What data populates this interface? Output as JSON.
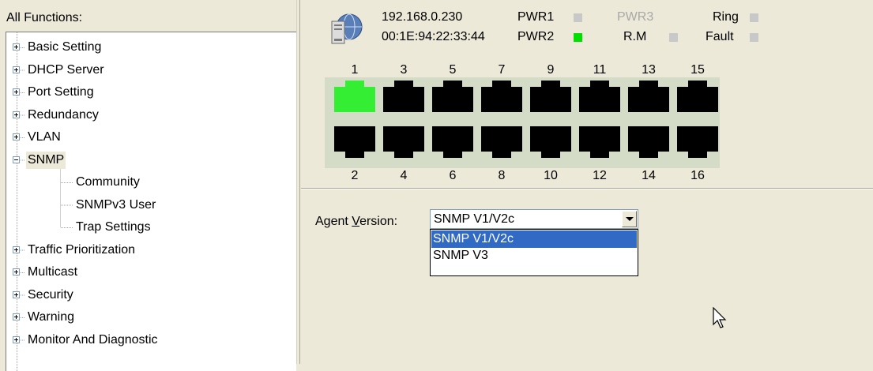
{
  "left": {
    "title": "All Functions:",
    "tree": [
      {
        "label": "Basic Setting",
        "expander": "plus"
      },
      {
        "label": "DHCP Server",
        "expander": "plus"
      },
      {
        "label": "Port Setting",
        "expander": "plus"
      },
      {
        "label": "Redundancy",
        "expander": "plus"
      },
      {
        "label": "VLAN",
        "expander": "plus"
      },
      {
        "label": "SNMP",
        "expander": "minus",
        "selected": true
      },
      {
        "label": "Community",
        "child": true
      },
      {
        "label": "SNMPv3 User",
        "child": true
      },
      {
        "label": "Trap Settings",
        "child": true
      },
      {
        "label": "Traffic Prioritization",
        "expander": "plus"
      },
      {
        "label": "Multicast",
        "expander": "plus"
      },
      {
        "label": "Security",
        "expander": "plus"
      },
      {
        "label": "Warning",
        "expander": "plus"
      },
      {
        "label": "Monitor And Diagnostic",
        "expander": "plus"
      }
    ]
  },
  "status": {
    "ip": "192.168.0.230",
    "mac": "00:1E:94:22:33:44",
    "pwr1": "PWR1",
    "pwr2": "PWR2",
    "pwr3": "PWR3",
    "rm": "R.M",
    "ring": "Ring",
    "fault": "Fault",
    "leds": {
      "pwr1": "off",
      "pwr2": "on",
      "rm": "off",
      "ring": "off",
      "fault": "off"
    },
    "led_colors": {
      "on": "#00e000",
      "off": "#c8c8c8"
    }
  },
  "ports": {
    "top": [
      "1",
      "3",
      "5",
      "7",
      "9",
      "11",
      "13",
      "15"
    ],
    "bottom": [
      "2",
      "4",
      "6",
      "8",
      "10",
      "12",
      "14",
      "16"
    ],
    "active": [
      "1"
    ],
    "colors": {
      "active": "#33ee33",
      "inactive": "#000000",
      "panel": "#d4dbc7"
    }
  },
  "config": {
    "agent_label_pre": "Agent ",
    "agent_label_key": "V",
    "agent_label_post": "ersion:",
    "agent_value": "SNMP V1/V2c",
    "options": [
      "SNMP V1/V2c",
      "SNMP V3"
    ],
    "selected_option": "SNMP V1/V2c"
  },
  "icons": {
    "device": "server-globe-icon",
    "cursor": "mouse-pointer-icon"
  }
}
